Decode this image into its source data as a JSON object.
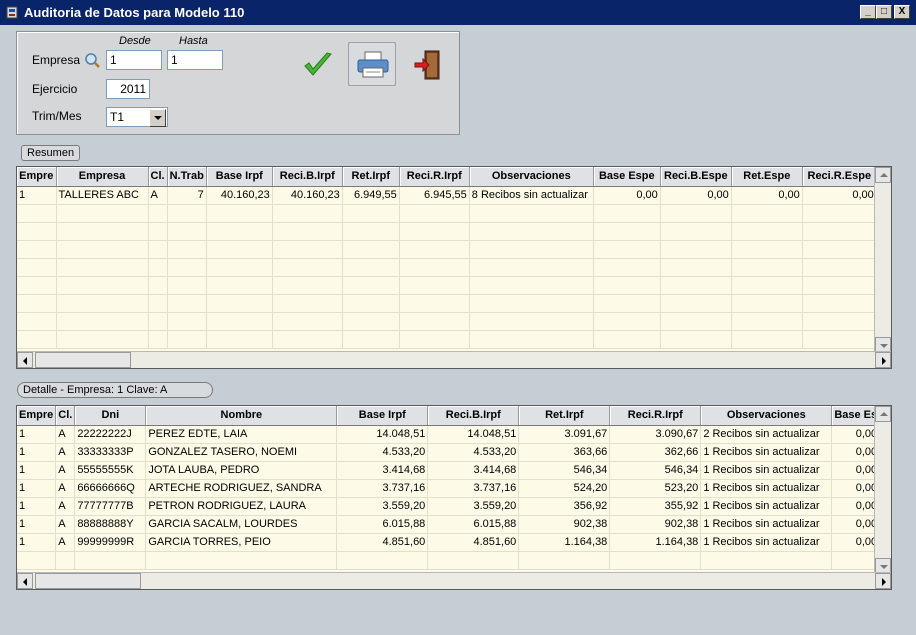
{
  "window": {
    "title": "Auditoria de Datos para Modelo 110",
    "minimize": "_",
    "maximize": "□",
    "close": "X"
  },
  "filters": {
    "desde_label": "Desde",
    "hasta_label": "Hasta",
    "empresa_label": "Empresa",
    "empresa_desde": "1",
    "empresa_hasta": "1",
    "ejercicio_label": "Ejercicio",
    "ejercicio_value": "2011",
    "trim_label": "Trim/Mes",
    "trim_value": "T1"
  },
  "buttons": {
    "accept_icon": "check-icon",
    "print_icon": "printer-icon",
    "exit_icon": "exit-door-icon"
  },
  "summary": {
    "tab_label": "Resumen",
    "columns": [
      "Empre",
      "Empresa",
      "Cl.",
      "N.Trab",
      "Base Irpf",
      "Reci.B.Irpf",
      "Ret.Irpf",
      "Reci.R.Irpf",
      "Observaciones",
      "Base Espe",
      "Reci.B.Espe",
      "Ret.Espe",
      "Reci.R.Espe"
    ],
    "rows": [
      [
        "1",
        "TALLERES ABC",
        "A",
        "7",
        "40.160,23",
        "40.160,23",
        "6.949,55",
        "6.945,55",
        "8 Recibos sin actualizar",
        "0,00",
        "0,00",
        "0,00",
        "0,00"
      ]
    ]
  },
  "detail": {
    "label": "Detalle - Empresa: 1   Clave: A",
    "columns": [
      "Empre",
      "Cl.",
      "Dni",
      "Nombre",
      "Base Irpf",
      "Reci.B.Irpf",
      "Ret.Irpf",
      "Reci.R.Irpf",
      "Observaciones",
      "Base Es"
    ],
    "rows": [
      [
        "1",
        "A",
        "22222222J",
        "PEREZ EDTE, LAIA",
        "14.048,51",
        "14.048,51",
        "3.091,67",
        "3.090,67",
        "2 Recibos sin actualizar",
        "0,00"
      ],
      [
        "1",
        "A",
        "33333333P",
        "GONZALEZ TASERO, NOEMI",
        "4.533,20",
        "4.533,20",
        "363,66",
        "362,66",
        "1 Recibos sin actualizar",
        "0,00"
      ],
      [
        "1",
        "A",
        "55555555K",
        "JOTA LAUBA, PEDRO",
        "3.414,68",
        "3.414,68",
        "546,34",
        "546,34",
        "1 Recibos sin actualizar",
        "0,00"
      ],
      [
        "1",
        "A",
        "66666666Q",
        "ARTECHE RODRIGUEZ, SANDRA",
        "3.737,16",
        "3.737,16",
        "524,20",
        "523,20",
        "1 Recibos sin actualizar",
        "0,00"
      ],
      [
        "1",
        "A",
        "77777777B",
        "PETRON RODRIGUEZ, LAURA",
        "3.559,20",
        "3.559,20",
        "356,92",
        "355,92",
        "1 Recibos sin actualizar",
        "0,00"
      ],
      [
        "1",
        "A",
        "88888888Y",
        "GARCIA SACALM, LOURDES",
        "6.015,88",
        "6.015,88",
        "902,38",
        "902,38",
        "1 Recibos sin actualizar",
        "0,00"
      ],
      [
        "1",
        "A",
        "99999999R",
        "GARCIA TORRES, PEIO",
        "4.851,60",
        "4.851,60",
        "1.164,38",
        "1.164,38",
        "1 Recibos sin actualizar",
        "0,00"
      ]
    ]
  }
}
